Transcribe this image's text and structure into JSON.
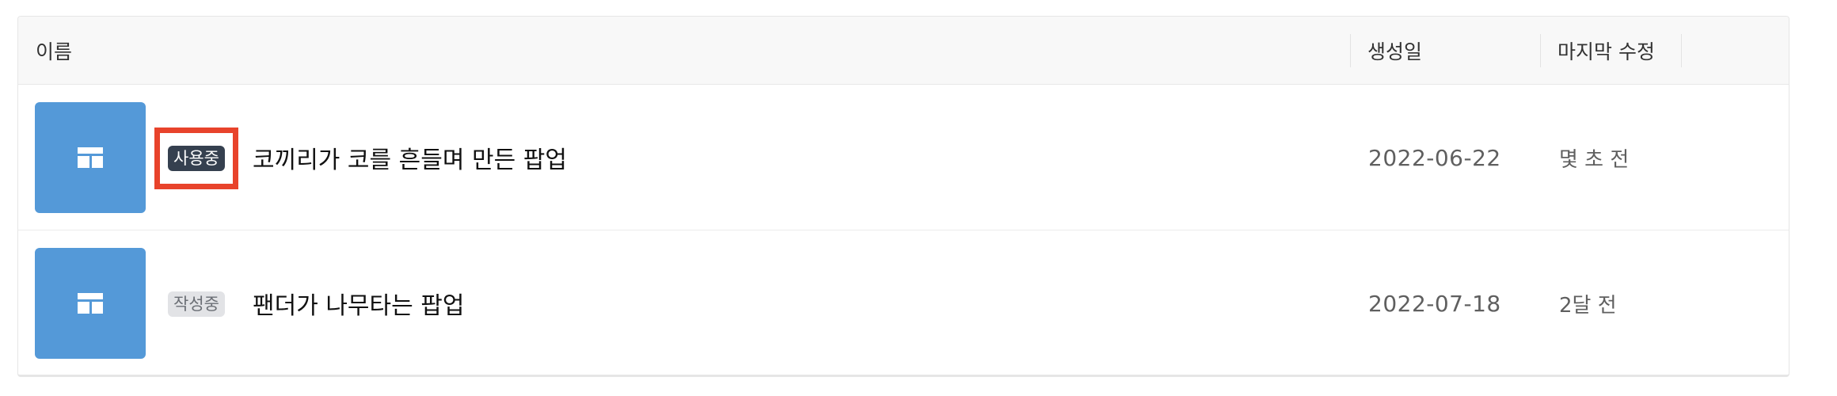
{
  "table": {
    "headers": {
      "name": "이름",
      "created": "생성일",
      "modified": "마지막 수정"
    },
    "rows": [
      {
        "thumbnail_icon": "layout-icon",
        "status": "사용중",
        "status_type": "active",
        "highlighted": true,
        "title": "코끼리가 코를 흔들며 만든 팝업",
        "created": "2022-06-22",
        "modified": "몇 초 전"
      },
      {
        "thumbnail_icon": "layout-icon",
        "status": "작성중",
        "status_type": "draft",
        "highlighted": false,
        "title": "팬더가 나무타는 팝업",
        "created": "2022-07-18",
        "modified": "2달 전"
      }
    ]
  },
  "colors": {
    "thumbnail_bg": "#5499d8",
    "active_badge_bg": "#35404f",
    "draft_badge_bg": "#e2e3e6",
    "highlight_border": "#e8432b"
  }
}
